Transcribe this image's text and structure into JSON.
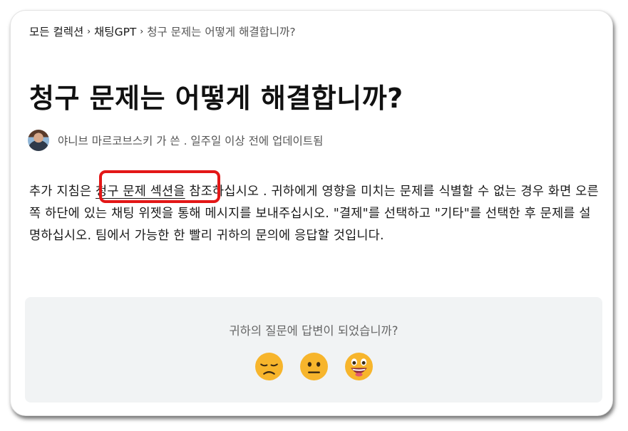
{
  "breadcrumb": {
    "items": [
      "모든 컬렉션",
      "채팅GPT",
      "청구 문제는 어떻게 해결합니까?"
    ],
    "separator": "›"
  },
  "article": {
    "title": "청구 문제는 어떻게 해결합니까?",
    "author_line": "야니브 마르코브스키 가 쓴 . 일주일 이상 전에 업데이트됨",
    "body": {
      "before_link": "추가 지침은 ",
      "link_text": "청구 문제 섹션을",
      "after_link": " 참조하십시오 . 귀하에게 영향을 미치는 문제를 식별할 수 없는 경우 화면 오른쪽 하단에 있는 채팅 위젯을 통해 메시지를 보내주십시오. \"결제\"를 선택하고 \"기타\"를 선택한 후 문제를 설명하십시오. 팀에서 가능한 한 빨리 귀하의 문의에 응답할 것입니다."
    }
  },
  "feedback": {
    "question": "귀하의 질문에 답변이 되었습니까?",
    "reactions": [
      "disappointed-face-icon",
      "neutral-face-icon",
      "smiley-face-icon"
    ]
  },
  "colors": {
    "highlight": "#e31717",
    "feedback_bg": "#f1f3f4",
    "emoji_fill": "#f7b52c"
  }
}
